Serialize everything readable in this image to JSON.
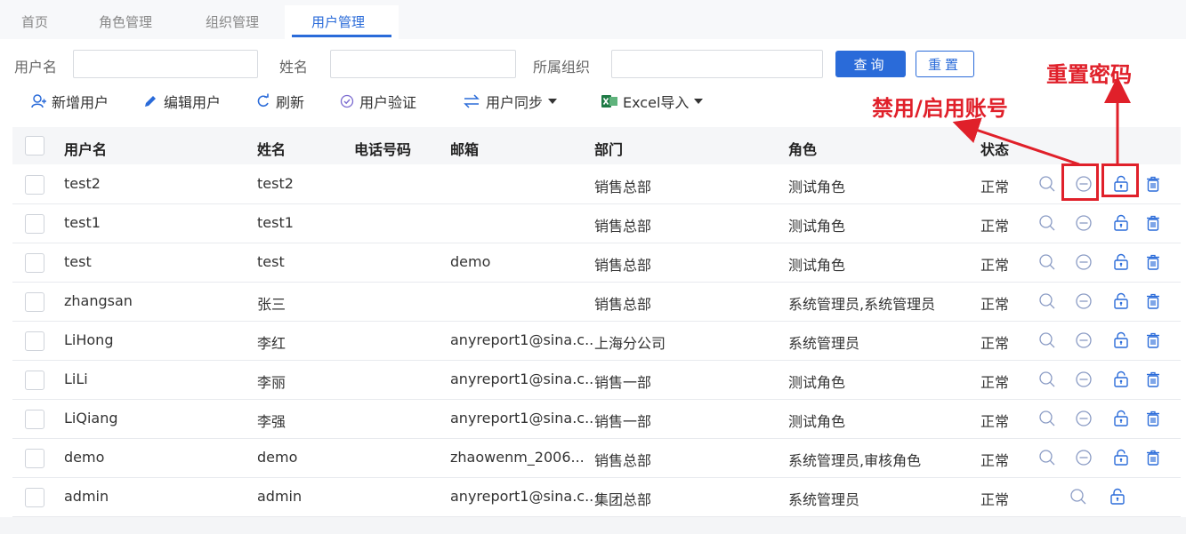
{
  "tabs": [
    {
      "label": "首页"
    },
    {
      "label": "角色管理"
    },
    {
      "label": "组织管理"
    },
    {
      "label": "用户管理",
      "active": true
    }
  ],
  "search": {
    "username_label": "用户名",
    "username_value": "",
    "name_label": "姓名",
    "name_value": "",
    "org_label": "所属组织",
    "org_value": "",
    "query_button": "查询",
    "reset_button": "重置"
  },
  "toolbar": {
    "add_user": "新增用户",
    "edit_user": "编辑用户",
    "refresh": "刷新",
    "verify_user": "用户验证",
    "sync_user": "用户同步",
    "excel_import": "Excel导入"
  },
  "annotations": {
    "reset_password": "重置密码",
    "disable_enable": "禁用/启用账号"
  },
  "colors": {
    "primary": "#2a6bd9",
    "annotation": "#e0202a"
  },
  "table": {
    "headers": [
      "用户名",
      "姓名",
      "电话号码",
      "邮箱",
      "部门",
      "角色",
      "状态"
    ],
    "rows": [
      {
        "username": "test2",
        "name": "test2",
        "phone": "",
        "email": "",
        "dept": "销售总部",
        "role": "测试角色",
        "status": "正常",
        "actions": [
          "search-icon",
          "disable-icon",
          "unlock-icon",
          "delete-icon"
        ]
      },
      {
        "username": "test1",
        "name": "test1",
        "phone": "",
        "email": "",
        "dept": "销售总部",
        "role": "测试角色",
        "status": "正常",
        "actions": [
          "search-icon",
          "disable-icon",
          "unlock-icon",
          "delete-icon"
        ]
      },
      {
        "username": "test",
        "name": "test",
        "phone": "",
        "email": "demo",
        "dept": "销售总部",
        "role": "测试角色",
        "status": "正常",
        "actions": [
          "search-icon",
          "disable-icon",
          "unlock-icon",
          "delete-icon"
        ]
      },
      {
        "username": "zhangsan",
        "name": "张三",
        "phone": "",
        "email": "",
        "dept": "销售总部",
        "role": "系统管理员,系统管理员",
        "status": "正常",
        "actions": [
          "search-icon",
          "disable-icon",
          "unlock-icon",
          "delete-icon"
        ]
      },
      {
        "username": "LiHong",
        "name": "李红",
        "phone": "",
        "email": "anyreport1@sina.c...",
        "dept": "上海分公司",
        "role": "系统管理员",
        "status": "正常",
        "actions": [
          "search-icon",
          "disable-icon",
          "unlock-icon",
          "delete-icon"
        ]
      },
      {
        "username": "LiLi",
        "name": "李丽",
        "phone": "",
        "email": "anyreport1@sina.c...",
        "dept": "销售一部",
        "role": "测试角色",
        "status": "正常",
        "actions": [
          "search-icon",
          "disable-icon",
          "unlock-icon",
          "delete-icon"
        ]
      },
      {
        "username": "LiQiang",
        "name": "李强",
        "phone": "",
        "email": "anyreport1@sina.c...",
        "dept": "销售一部",
        "role": "测试角色",
        "status": "正常",
        "actions": [
          "search-icon",
          "disable-icon",
          "unlock-icon",
          "delete-icon"
        ]
      },
      {
        "username": "demo",
        "name": "demo",
        "phone": "",
        "email": "zhaowenm_2006...",
        "dept": "销售总部",
        "role": "系统管理员,审核角色",
        "status": "正常",
        "actions": [
          "search-icon",
          "disable-icon",
          "unlock-icon",
          "delete-icon"
        ]
      },
      {
        "username": "admin",
        "name": "admin",
        "phone": "",
        "email": "anyreport1@sina.c...",
        "dept": "集团总部",
        "role": "系统管理员",
        "status": "正常",
        "actions": [
          "search-icon",
          "unlock-icon"
        ]
      }
    ]
  }
}
